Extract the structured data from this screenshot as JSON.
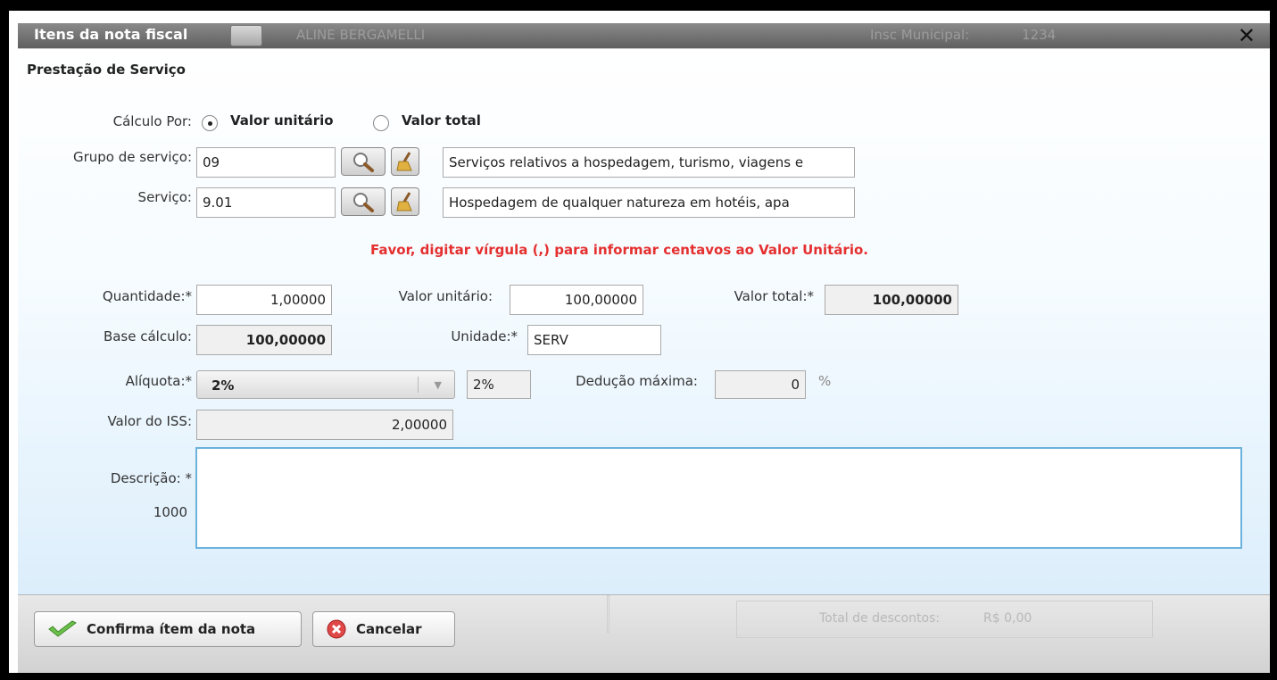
{
  "dialog": {
    "title": "Itens da nota fiscal",
    "background_name": "ALINE BERGAMELLI",
    "background_insc_label": "Insc Municipal:",
    "background_insc_value": "1234",
    "close_label": "✕"
  },
  "section_title": "Prestação de Serviço",
  "calculo": {
    "label": "Cálculo Por:",
    "option_unitario": "Valor unitário",
    "option_total": "Valor total",
    "selected": "unitario"
  },
  "grupo": {
    "label": "Grupo de serviço:",
    "code": "09",
    "description": "Serviços relativos a hospedagem, turismo, viagens e"
  },
  "servico": {
    "label": "Serviço:",
    "code": "9.01",
    "description": "Hospedagem de qualquer natureza em hotéis, apa"
  },
  "warning": "Favor, digitar vírgula (,) para informar centavos ao Valor Unitário.",
  "fields": {
    "quantidade_label": "Quantidade:*",
    "quantidade_value": "1,00000",
    "valor_unitario_label": "Valor unitário:",
    "valor_unitario_value": "100,00000",
    "valor_total_label": "Valor total:*",
    "valor_total_value": "100,00000",
    "base_calculo_label": "Base cálculo:",
    "base_calculo_value": "100,00000",
    "unidade_label": "Unidade:*",
    "unidade_value": "SERV",
    "aliquota_label": "Alíquota:*",
    "aliquota_select": "2%",
    "aliquota_value": "2%",
    "deducao_label": "Dedução máxima:",
    "deducao_value": "0",
    "percent": "%",
    "valor_iss_label": "Valor do ISS:",
    "valor_iss_value": "2,00000",
    "descricao_label": "Descrição: *",
    "descricao_counter": "1000"
  },
  "buttons": {
    "confirm": "Confirma ítem da nota",
    "cancel": "Cancelar"
  },
  "background_footer": {
    "descontos_label": "Total de descontos:",
    "descontos_value": "R$ 0,00"
  },
  "colors": {
    "warning": "#e53030",
    "textarea_border": "#6bb2dc",
    "titlebar": "#6f6f6f"
  }
}
